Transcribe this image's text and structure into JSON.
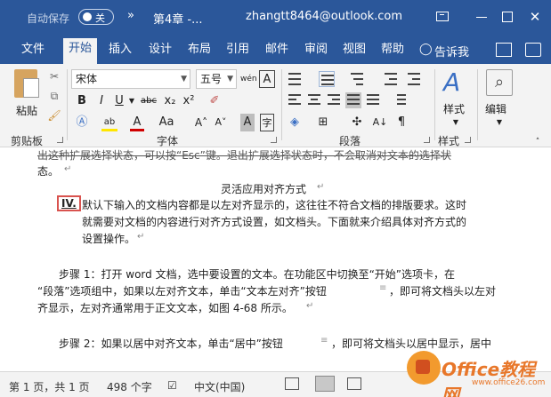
{
  "titlebar": {
    "autosave_label": "自动保存",
    "autosave_state": "关",
    "qat_more": "»",
    "doc_title": "第4章 -...",
    "account": "zhangtt8464@outlook.com",
    "minimize": "—",
    "close": "✕"
  },
  "tabs": [
    "文件",
    "开始",
    "插入",
    "设计",
    "布局",
    "引用",
    "邮件",
    "审阅",
    "视图",
    "帮助"
  ],
  "active_tab": "开始",
  "tell_me": "告诉我",
  "ribbon": {
    "clipboard": {
      "paste": "粘贴",
      "label": "剪贴板"
    },
    "font": {
      "name": "宋体",
      "size": "五号",
      "wen": "wén",
      "char_border": "A",
      "bold": "B",
      "italic": "I",
      "underline": "U",
      "strike": "abc",
      "sub": "x₂",
      "sup": "x²",
      "aa": "Aa",
      "grow": "A˄",
      "shrink": "A˅",
      "shade_a": "A",
      "label": "字体"
    },
    "paragraph": {
      "label": "段落"
    },
    "styles": {
      "button": "样式",
      "label": "样式"
    },
    "editing": {
      "button": "编辑"
    }
  },
  "document": {
    "line_top": "出这种扩展选择状态，可以按“Esc”键。退出扩展选择状态时，不会取消对文本的选择状",
    "line_top2": "态。",
    "heading": "灵活应用对齐方式",
    "list_marker": "IV.",
    "item_line1": "默认下输入的文档内容都是以左对齐显示的，这往往不符合文档的排版要求。这时",
    "item_line2": "就需要对文档的内容进行对齐方式设置，如文档头。下面就来介绍具体对齐方式的",
    "item_line3": "设置操作。",
    "step1_line1": "步骤 1：打开 word 文档，选中要设置的文本。在功能区中切换至“开始”选项卡，在",
    "step1_line2": "“段落”选项组中，如果以左对齐文本，单击“文本左对齐”按钮",
    "step1_line2b": "，即可将文档头以左对",
    "step1_line3": "齐显示，左对齐通常用于正文文本，如图 4-68 所示。",
    "step2_line1": "步骤 2：如果以居中对齐文本，单击“居中”按钮",
    "step2_line1b": "，即可将文档头以居中显示，居中",
    "pmark": "↵"
  },
  "status": {
    "page": "第 1 页，共 1 页",
    "words": "498 个字",
    "lang": "中文(中国)"
  },
  "watermark": {
    "brand": "Office教程网",
    "url": "www.office26.com"
  }
}
